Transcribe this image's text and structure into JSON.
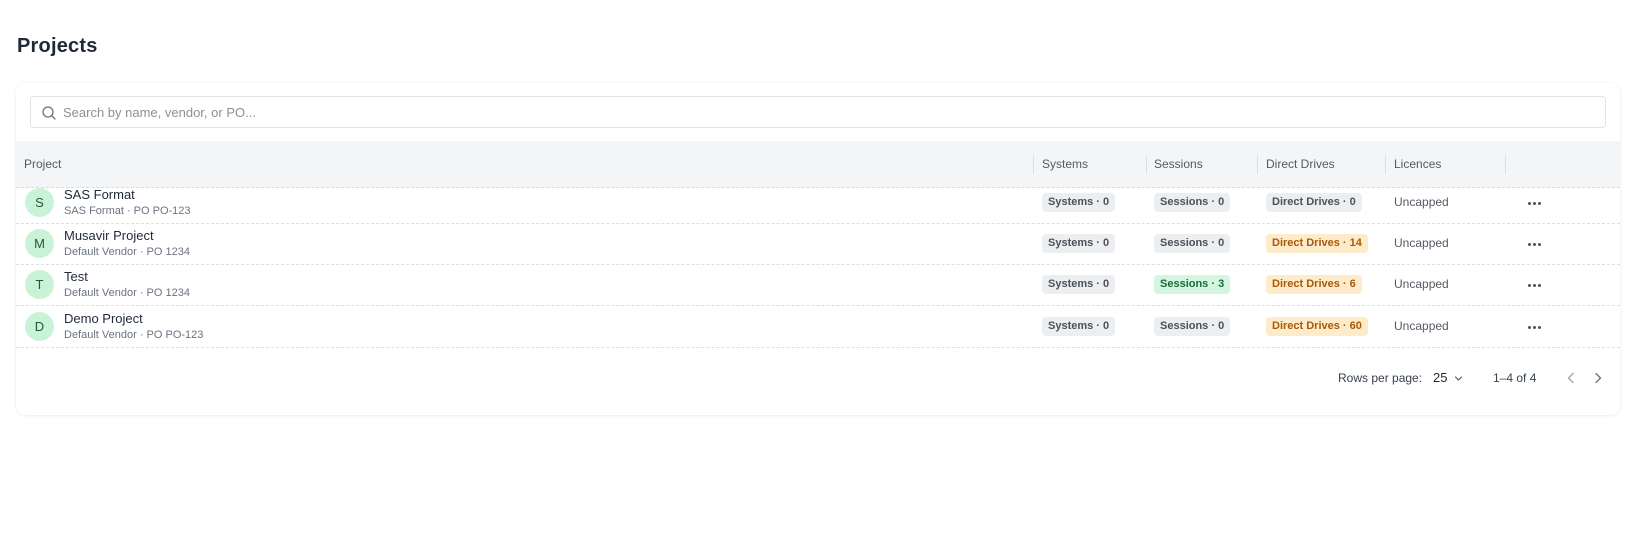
{
  "page": {
    "title": "Projects"
  },
  "search": {
    "placeholder": "Search by name, vendor, or PO..."
  },
  "table": {
    "headers": {
      "project": "Project",
      "systems": "Systems",
      "sessions": "Sessions",
      "direct_drives": "Direct Drives",
      "licences": "Licences"
    },
    "rows": [
      {
        "initial": "S",
        "name": "SAS Format",
        "subtitle": "SAS Format · PO PO-123",
        "systems": "Systems · 0",
        "sessions": "Sessions · 0",
        "direct_drives": "Direct Drives · 0",
        "licences": "Uncapped"
      },
      {
        "initial": "M",
        "name": "Musavir Project",
        "subtitle": "Default Vendor · PO 1234",
        "systems": "Systems · 0",
        "sessions": "Sessions · 0",
        "direct_drives": "Direct Drives · 14",
        "licences": "Uncapped"
      },
      {
        "initial": "T",
        "name": "Test",
        "subtitle": "Default Vendor · PO 1234",
        "systems": "Systems · 0",
        "sessions": "Sessions · 3",
        "direct_drives": "Direct Drives · 6",
        "licences": "Uncapped"
      },
      {
        "initial": "D",
        "name": "Demo Project",
        "subtitle": "Default Vendor · PO PO-123",
        "systems": "Systems · 0",
        "sessions": "Sessions · 0",
        "direct_drives": "Direct Drives · 60",
        "licences": "Uncapped"
      }
    ]
  },
  "pagination": {
    "rows_per_page_label": "Rows per page:",
    "rows_per_page_value": "25",
    "range_text": "1–4 of 4"
  },
  "icons": {
    "search": "search-icon",
    "more": "more-horizontal-icon",
    "dropdown": "chevron-down-icon",
    "prev": "chevron-left-icon",
    "next": "chevron-right-icon"
  },
  "colors": {
    "avatar_bg": "#c9f3d6",
    "badge_neutral": "#eceef0",
    "badge_success": "#d4f5e0",
    "badge_warning": "#fdebc9"
  }
}
